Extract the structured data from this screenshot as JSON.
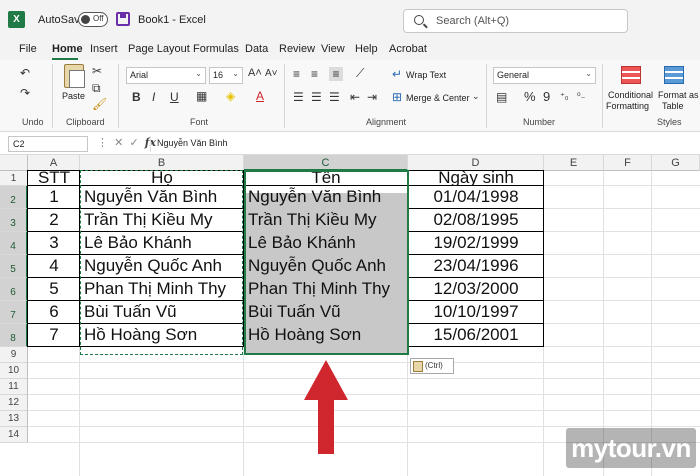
{
  "titlebar": {
    "autosave_label": "AutoSave",
    "autosave_state": "Off",
    "doc_title": "Book1  -  Excel",
    "search_placeholder": "Search (Alt+Q)"
  },
  "menu": {
    "tabs": [
      "File",
      "Home",
      "Insert",
      "Page Layout",
      "Formulas",
      "Data",
      "Review",
      "View",
      "Help",
      "Acrobat"
    ],
    "active": "Home"
  },
  "ribbon": {
    "undo_label": "Undo",
    "clipboard_label": "Clipboard",
    "paste_label": "Paste",
    "font_label": "Font",
    "font_name": "Arial",
    "font_size": "16",
    "alignment_label": "Alignment",
    "wrap_text": "Wrap Text",
    "merge_center": "Merge & Center",
    "number_label": "Number",
    "number_format": "General",
    "styles_label": "Styles",
    "conditional_formatting_1": "Conditional",
    "conditional_formatting_2": "Formatting",
    "format_as_table_1": "Format as",
    "format_as_table_2": "Table",
    "bold": "B",
    "italic": "I",
    "underline": "U",
    "font_color": "A",
    "currency": "$",
    "percent": "%",
    "comma": "9"
  },
  "formula_bar": {
    "name_box": "C2",
    "fx": "fx",
    "content": "Nguyễn Văn Bình"
  },
  "grid": {
    "columns": [
      "A",
      "B",
      "C",
      "D",
      "E",
      "F",
      "G"
    ],
    "rows": [
      "1",
      "2",
      "3",
      "4",
      "5",
      "6",
      "7",
      "8",
      "9",
      "10",
      "11",
      "12",
      "13",
      "14"
    ],
    "headers": [
      "STT",
      "Họ",
      "Tên",
      "Ngày sinh"
    ],
    "data": [
      [
        "1",
        "Nguyễn Văn Bình",
        "Nguyễn Văn Bình",
        "01/04/1998"
      ],
      [
        "2",
        "Trần Thị Kiều My",
        "Trần Thị Kiều My",
        "02/08/1995"
      ],
      [
        "3",
        "Lê Bảo Khánh",
        "Lê Bảo Khánh",
        "19/02/1999"
      ],
      [
        "4",
        "Nguyễn Quốc Anh",
        "Nguyễn Quốc Anh",
        "23/04/1996"
      ],
      [
        "5",
        "Phan Thị Minh Thy",
        "Phan Thị Minh Thy",
        "12/03/2000"
      ],
      [
        "6",
        "Bùi Tuấn Vũ",
        "Bùi Tuấn Vũ",
        "10/10/1997"
      ],
      [
        "7",
        "Hồ Hoàng Sơn",
        "Hồ Hoàng Sơn",
        "15/06/2001"
      ]
    ],
    "paste_options": "(Ctrl)"
  },
  "colors": {
    "accent": "#1f7a45",
    "arrow": "#d0262e",
    "selection_fill": "#c8c8c8"
  },
  "watermark": "mytour.vn"
}
